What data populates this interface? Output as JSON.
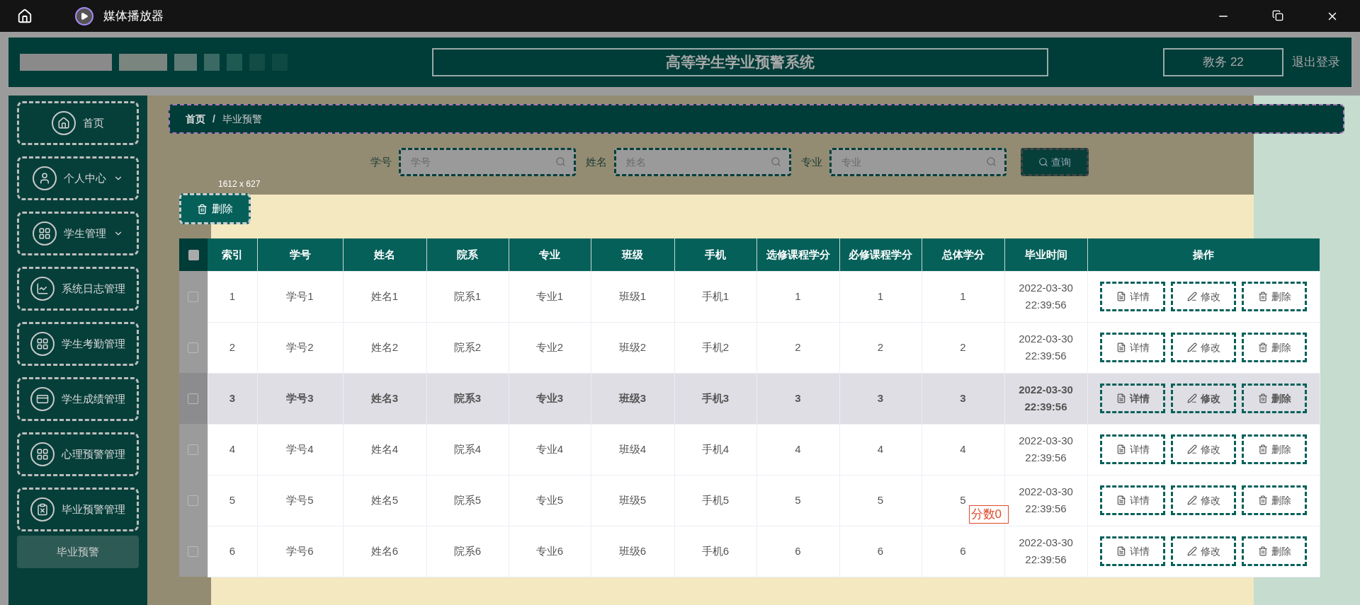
{
  "titlebar": {
    "app_name": "媒体播放器"
  },
  "header": {
    "title": "高等学生学业预警系统",
    "user": "教务 22",
    "logout": "退出登录"
  },
  "sidebar": {
    "items": [
      {
        "label": "首页",
        "kind": "home",
        "has_arrow": false
      },
      {
        "label": "个人中心",
        "kind": "user",
        "has_arrow": true
      },
      {
        "label": "学生管理",
        "kind": "grid",
        "has_arrow": true
      },
      {
        "label": "系统日志管理",
        "kind": "chart",
        "has_arrow": false
      },
      {
        "label": "学生考勤管理",
        "kind": "grid",
        "has_arrow": false
      },
      {
        "label": "学生成绩管理",
        "kind": "card",
        "has_arrow": false
      },
      {
        "label": "心理预警管理",
        "kind": "grid",
        "has_arrow": false
      },
      {
        "label": "毕业预警管理",
        "kind": "clipboard",
        "has_arrow": false,
        "children": [
          {
            "label": "毕业预警",
            "selected": true
          }
        ]
      }
    ]
  },
  "breadcrumb": {
    "items": [
      "首页",
      "毕业预警"
    ],
    "separator": "/"
  },
  "search": {
    "fields": [
      {
        "label": "学号",
        "placeholder": "学号"
      },
      {
        "label": "姓名",
        "placeholder": "姓名"
      },
      {
        "label": "专业",
        "placeholder": "专业"
      }
    ],
    "button": "查询"
  },
  "delete_button": "删除",
  "capture_size": "1612 x 627",
  "table": {
    "select_all": false,
    "columns": [
      "索引",
      "学号",
      "姓名",
      "院系",
      "专业",
      "班级",
      "手机",
      "选修课程学分",
      "必修课程学分",
      "总体学分",
      "毕业时间",
      "操作"
    ],
    "rows": [
      {
        "selected": false,
        "highlighted": false,
        "cells": [
          "1",
          "学号1",
          "姓名1",
          "院系1",
          "专业1",
          "班级1",
          "手机1",
          "1",
          "1",
          "1",
          "2022-03-30 22:39:56"
        ],
        "actions": [
          "详情",
          "修改",
          "删除"
        ]
      },
      {
        "selected": false,
        "highlighted": false,
        "cells": [
          "2",
          "学号2",
          "姓名2",
          "院系2",
          "专业2",
          "班级2",
          "手机2",
          "2",
          "2",
          "2",
          "2022-03-30 22:39:56"
        ],
        "actions": [
          "详情",
          "修改",
          "删除"
        ]
      },
      {
        "selected": false,
        "highlighted": true,
        "cells": [
          "3",
          "学号3",
          "姓名3",
          "院系3",
          "专业3",
          "班级3",
          "手机3",
          "3",
          "3",
          "3",
          "2022-03-30 22:39:56"
        ],
        "actions": [
          "详情",
          "修改",
          "删除"
        ]
      },
      {
        "selected": false,
        "highlighted": false,
        "cells": [
          "4",
          "学号4",
          "姓名4",
          "院系4",
          "专业4",
          "班级4",
          "手机4",
          "4",
          "4",
          "4",
          "2022-03-30 22:39:56"
        ],
        "actions": [
          "详情",
          "修改",
          "删除"
        ]
      },
      {
        "selected": false,
        "highlighted": false,
        "cells": [
          "5",
          "学号5",
          "姓名5",
          "院系5",
          "专业5",
          "班级5",
          "手机5",
          "5",
          "5",
          "5",
          "2022-03-30 22:39:56"
        ],
        "actions": [
          "详情",
          "修改",
          "删除"
        ],
        "annotation": "分数0"
      },
      {
        "selected": false,
        "highlighted": false,
        "cells": [
          "6",
          "学号6",
          "姓名6",
          "院系6",
          "专业6",
          "班级6",
          "手机6",
          "6",
          "6",
          "6",
          "2022-03-30 22:39:56"
        ],
        "actions": [
          "详情",
          "修改",
          "删除"
        ]
      }
    ]
  }
}
